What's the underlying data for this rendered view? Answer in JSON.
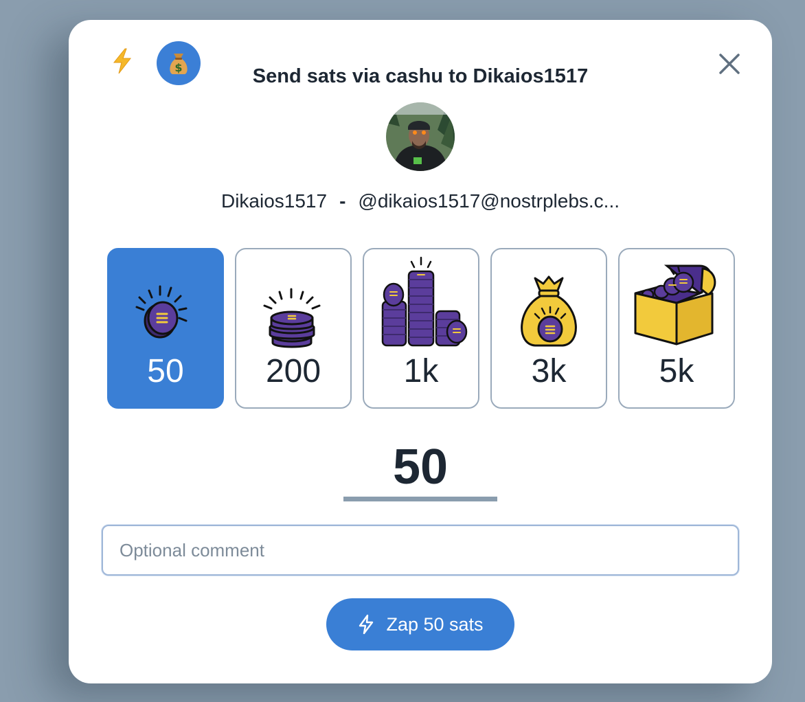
{
  "dialog": {
    "title": "Send sats via cashu to Dikaios1517",
    "close_icon": "close-icon",
    "methods": [
      {
        "name": "lightning",
        "icon": "lightning-icon",
        "glyph": "⚡"
      },
      {
        "name": "cashu",
        "icon": "money-bag-icon",
        "glyph": "💰",
        "selected": true
      }
    ]
  },
  "recipient": {
    "display_name": "Dikaios1517",
    "separator": "-",
    "nip05": "@dikaios1517@nostrplebs.c..."
  },
  "amounts": [
    {
      "label": "50",
      "icon": "single-coin-icon",
      "selected": true
    },
    {
      "label": "200",
      "icon": "coin-stack-icon",
      "selected": false
    },
    {
      "label": "1k",
      "icon": "coin-piles-icon",
      "selected": false
    },
    {
      "label": "3k",
      "icon": "money-bag-icon",
      "selected": false
    },
    {
      "label": "5k",
      "icon": "treasure-chest-icon",
      "selected": false
    }
  ],
  "selected_amount": "50",
  "comment": {
    "placeholder": "Optional comment",
    "value": ""
  },
  "zap_button": {
    "label": "Zap 50 sats",
    "icon": "bolt-icon"
  },
  "colors": {
    "accent": "#3a7fd5",
    "overlay": "#8a9dae",
    "coin": "#5b3d9c",
    "gold": "#f2ca3c"
  }
}
